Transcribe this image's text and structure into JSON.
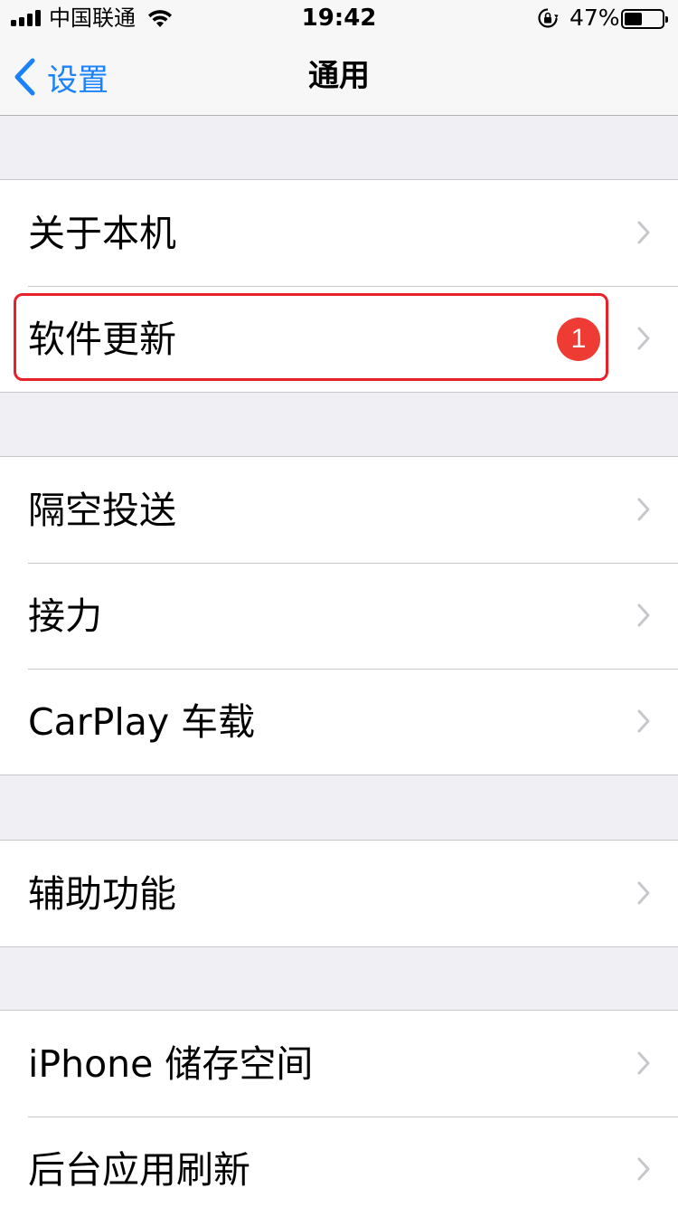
{
  "status_bar": {
    "carrier": "中国联通",
    "time": "19:42",
    "battery_percent": "47%",
    "battery_level": 0.47,
    "signal_bars": 4
  },
  "nav": {
    "back_label": "设置",
    "title": "通用"
  },
  "groups": [
    {
      "rows": [
        {
          "label": "关于本机"
        },
        {
          "label": "软件更新",
          "badge": "1",
          "highlighted": true
        }
      ]
    },
    {
      "rows": [
        {
          "label": "隔空投送"
        },
        {
          "label": "接力"
        },
        {
          "label": "CarPlay 车载"
        }
      ]
    },
    {
      "rows": [
        {
          "label": "辅助功能"
        }
      ]
    },
    {
      "rows": [
        {
          "label": "iPhone 储存空间"
        },
        {
          "label": "后台应用刷新"
        }
      ]
    }
  ],
  "colors": {
    "accent": "#1a82fb",
    "badge": "#ee3b34",
    "highlight_box": "#e8202a",
    "background": "#efeff4"
  }
}
